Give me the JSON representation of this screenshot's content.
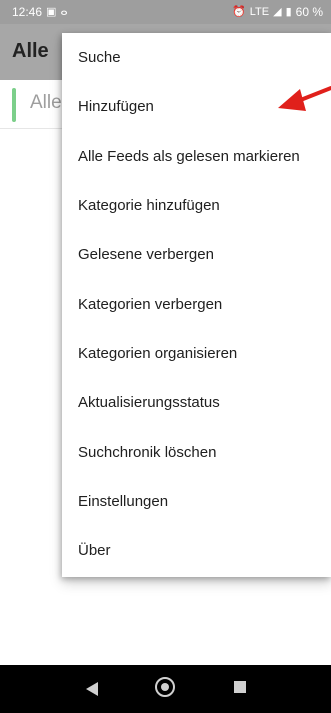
{
  "statusbar": {
    "time": "12:46",
    "battery": "60 %",
    "icons": {
      "left": [
        "notification-image-icon",
        "notification-app-icon"
      ],
      "right": [
        "alarm-icon",
        "lte-icon",
        "signal-icon",
        "battery-icon"
      ]
    }
  },
  "appbar": {
    "title": "Alle"
  },
  "list": {
    "first_item_label": "Alle",
    "accent_color": "#7ccf8a"
  },
  "menu": {
    "items": [
      {
        "label": "Suche"
      },
      {
        "label": "Hinzufügen"
      },
      {
        "label": "Alle Feeds als gelesen markieren"
      },
      {
        "label": "Kategorie hinzufügen"
      },
      {
        "label": "Gelesene verbergen"
      },
      {
        "label": "Kategorien verbergen"
      },
      {
        "label": "Kategorien organisieren"
      },
      {
        "label": "Aktualisierungsstatus"
      },
      {
        "label": "Suchchronik löschen"
      },
      {
        "label": "Einstellungen"
      },
      {
        "label": "Über"
      }
    ]
  },
  "annotation": {
    "arrow_color": "#e0201b",
    "points_to": "Hinzufügen"
  },
  "navbar": {
    "icons": [
      "back-icon",
      "home-icon",
      "recents-icon"
    ]
  }
}
